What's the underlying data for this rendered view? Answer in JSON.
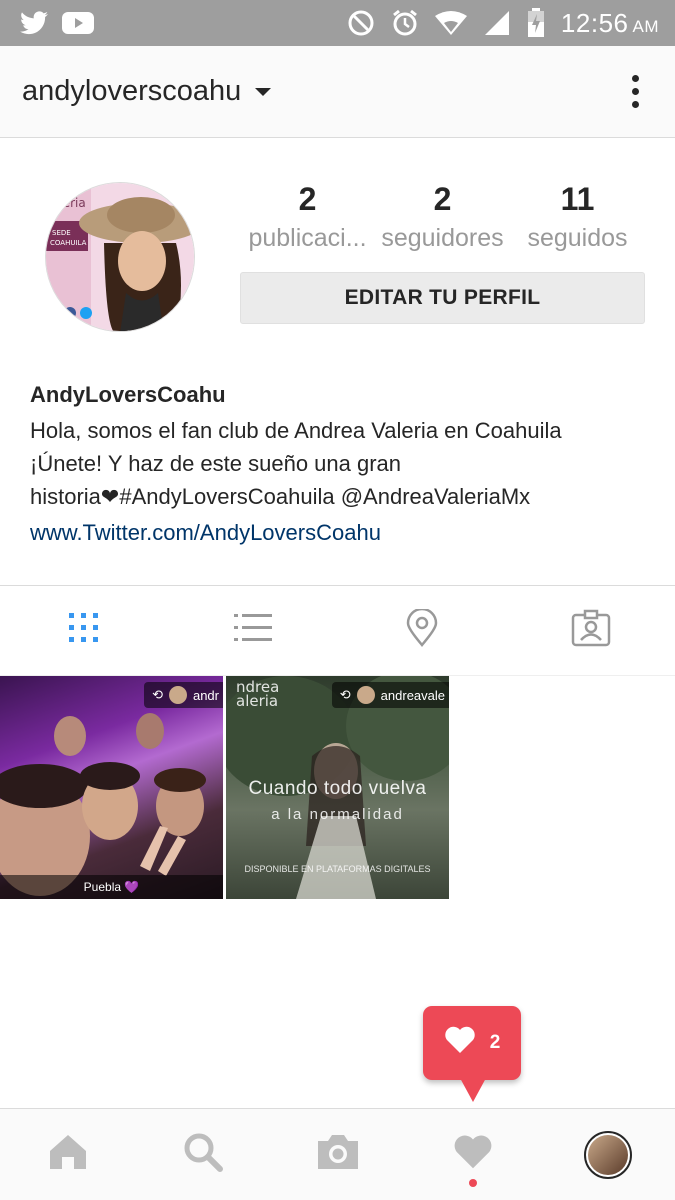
{
  "status_bar": {
    "time": "12:56",
    "ampm": "AM",
    "left_icons": [
      "twitter-icon",
      "youtube-icon"
    ],
    "right_icons": [
      "do-not-disturb-icon",
      "alarm-icon",
      "wifi-icon",
      "signal-icon",
      "battery-icon"
    ]
  },
  "header": {
    "username": "andyloverscoahu"
  },
  "profile": {
    "stats": [
      {
        "count": "2",
        "label": "publicaci..."
      },
      {
        "count": "2",
        "label": "seguidores"
      },
      {
        "count": "11",
        "label": "seguidos"
      }
    ],
    "edit_button": "EDITAR TU PERFIL",
    "display_name": "AndyLoversCoahu",
    "bio_line1": "Hola, somos el fan club de Andrea Valeria en Coahuila",
    "bio_line2": "¡Únete! Y haz de este sueño una gran",
    "bio_line3": "historia❤#AndyLoversCoahuila @AndreaValeriaMx",
    "website": "www.Twitter.com/AndyLoversCoahu"
  },
  "tabs": [
    "grid-icon",
    "list-icon",
    "location-icon",
    "tagged-icon"
  ],
  "posts": [
    {
      "repost_user": "andr",
      "caption": "Puebla 💜"
    },
    {
      "repost_user": "andreavale",
      "overlay_title_1": "ndrea",
      "overlay_title_2": "aleria",
      "overlay_main": "Cuando todo vuelva",
      "overlay_sub": "a la normalidad",
      "overlay_small": "DISPONIBLE EN PLATAFORMAS DIGITALES"
    }
  ],
  "notification": {
    "count": "2"
  },
  "bottom_nav": [
    "home-icon",
    "search-icon",
    "camera-icon",
    "heart-icon",
    "profile-avatar"
  ],
  "colors": {
    "status_bar": "#9e9e9e",
    "accent_blue": "#3897f0",
    "like_red": "#ed4956",
    "link": "#003569"
  }
}
